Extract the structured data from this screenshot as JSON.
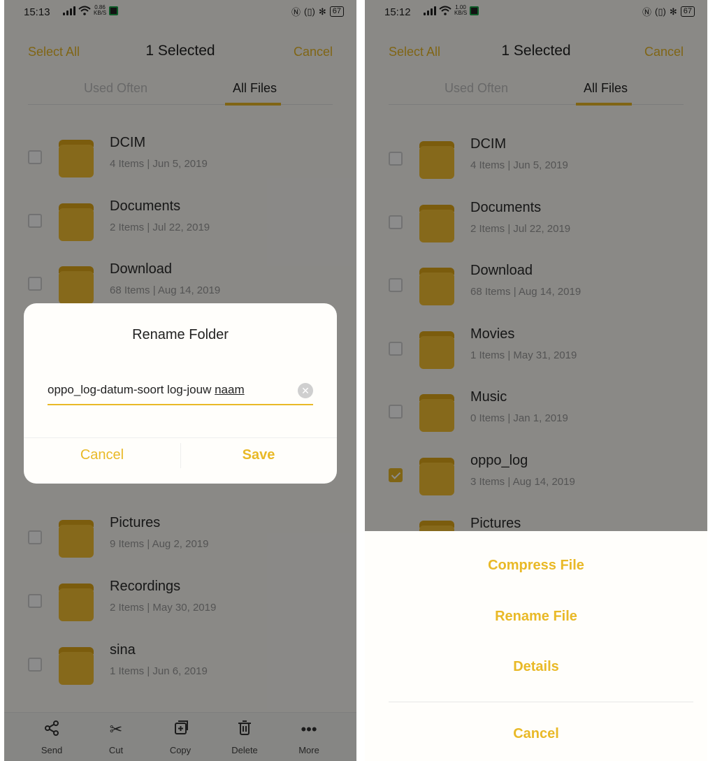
{
  "status_left": {
    "time": "15:13",
    "speed": "0.86 KB/S",
    "battery": "67"
  },
  "status_right": {
    "time": "15:12",
    "speed": "1.00 KB/S",
    "battery": "67"
  },
  "header": {
    "select_all": "Select All",
    "title": "1 Selected",
    "cancel": "Cancel"
  },
  "tabs": [
    {
      "label": "Used Often"
    },
    {
      "label": "All Files"
    }
  ],
  "left_rows": [
    {
      "name": "DCIM",
      "meta": "4 Items | Jun 5, 2019"
    },
    {
      "name": "Documents",
      "meta": "2 Items | Jul 22, 2019"
    },
    {
      "name": "Download",
      "meta": "68 Items | Aug 14, 2019"
    },
    {
      "name": "Pictures",
      "meta": "9 Items | Aug 2, 2019"
    },
    {
      "name": "Recordings",
      "meta": "2 Items | May 30, 2019"
    },
    {
      "name": "sina",
      "meta": "1 Items | Jun 6, 2019"
    }
  ],
  "right_rows": [
    {
      "name": "DCIM",
      "meta": "4 Items | Jun 5, 2019"
    },
    {
      "name": "Documents",
      "meta": "2 Items | Jul 22, 2019"
    },
    {
      "name": "Download",
      "meta": "68 Items | Aug 14, 2019"
    },
    {
      "name": "Movies",
      "meta": "1 Items | May 31, 2019"
    },
    {
      "name": "Music",
      "meta": "0 Items | Jan 1, 2019"
    },
    {
      "name": "oppo_log",
      "meta": "3 Items | Aug 14, 2019",
      "checked": true
    },
    {
      "name": "Pictures",
      "meta": ""
    }
  ],
  "bottom_bar": [
    {
      "label": "Send",
      "icon": "share-icon"
    },
    {
      "label": "Cut",
      "icon": "scissors-icon"
    },
    {
      "label": "Copy",
      "icon": "copy-icon"
    },
    {
      "label": "Delete",
      "icon": "trash-icon"
    },
    {
      "label": "More",
      "icon": "more-icon"
    }
  ],
  "dialog": {
    "title": "Rename Folder",
    "input_text": "oppo_log-datum-soort log-jouw ",
    "input_underlined": "naam",
    "cancel": "Cancel",
    "save": "Save"
  },
  "sheet": {
    "compress": "Compress File",
    "rename": "Rename File",
    "details": "Details",
    "cancel": "Cancel"
  },
  "colors": {
    "accent": "#e9b927",
    "folder": "#f4c032"
  }
}
